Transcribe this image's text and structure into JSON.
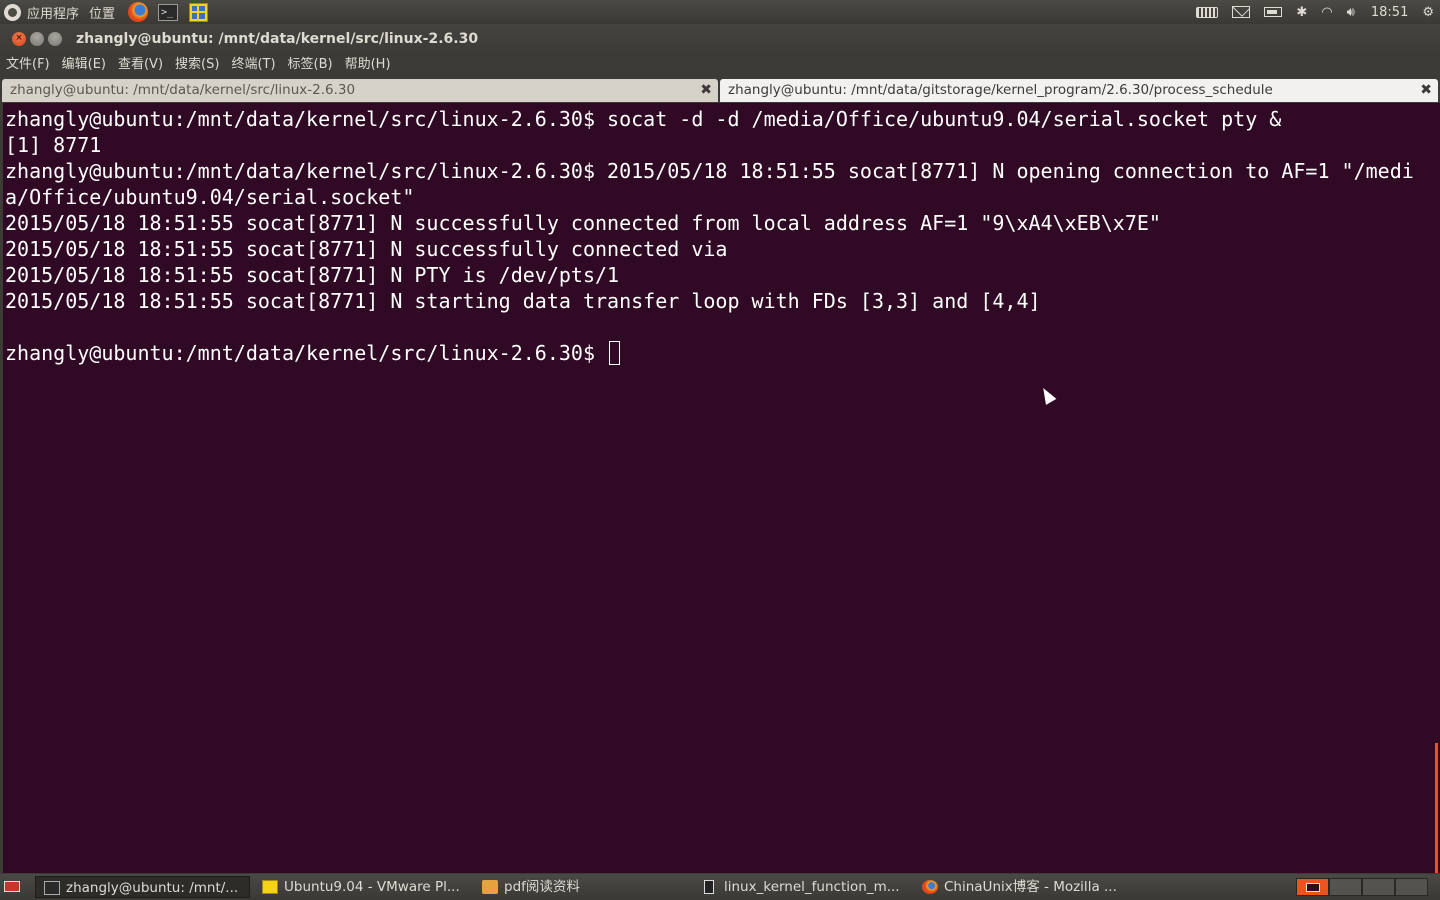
{
  "top_panel": {
    "applications_menu": "应用程序",
    "places_menu": "位置",
    "launchers": [
      "firefox-icon",
      "terminal-icon",
      "vmware-icon"
    ],
    "tray": [
      "keyboard-icon",
      "mail-icon",
      "battery-icon",
      "bluetooth-icon",
      "wifi-icon",
      "volume-icon"
    ],
    "clock": "18:51",
    "power_icon": "⚙"
  },
  "window": {
    "title": "zhangly@ubuntu: /mnt/data/kernel/src/linux-2.6.30",
    "buttons": {
      "close": "×",
      "minimize": "−",
      "maximize": "□"
    }
  },
  "menubar": {
    "items": [
      "文件(F)",
      "编辑(E)",
      "查看(V)",
      "搜索(S)",
      "终端(T)",
      "标签(B)",
      "帮助(H)"
    ]
  },
  "tabs": [
    {
      "label": "zhangly@ubuntu: /mnt/data/kernel/src/linux-2.6.30",
      "close": "✖",
      "active": true
    },
    {
      "label": "zhangly@ubuntu: /mnt/data/gitstorage/kernel_program/2.6.30/process_schedule",
      "close": "✖",
      "active": false
    }
  ],
  "terminal": {
    "background": "#300a24",
    "foreground": "#ffffff",
    "output": "zhangly@ubuntu:/mnt/data/kernel/src/linux-2.6.30$ socat -d -d /media/Office/ubuntu9.04/serial.socket pty &\n[1] 8771\nzhangly@ubuntu:/mnt/data/kernel/src/linux-2.6.30$ 2015/05/18 18:51:55 socat[8771] N opening connection to AF=1 \"/media/Office/ubuntu9.04/serial.socket\"\n2015/05/18 18:51:55 socat[8771] N successfully connected from local address AF=1 \"9\\xA4\\xEB\\x7E\"\n2015/05/18 18:51:55 socat[8771] N successfully connected via\n2015/05/18 18:51:55 socat[8771] N PTY is /dev/pts/1\n2015/05/18 18:51:55 socat[8771] N starting data transfer loop with FDs [3,3] and [4,4]\n\n",
    "prompt": "zhangly@ubuntu:/mnt/data/kernel/src/linux-2.6.30$ "
  },
  "taskbar": {
    "tasks": [
      {
        "label": "zhangly@ubuntu: /mnt/...",
        "icon": "terminal-icon",
        "active": true
      },
      {
        "label": "Ubuntu9.04 - VMware Pl...",
        "icon": "vmware-icon",
        "active": false
      },
      {
        "label": "pdf阅读资料",
        "icon": "folder-icon",
        "active": false
      },
      {
        "label": "linux_kernel_function_m...",
        "icon": "document-icon",
        "active": false
      },
      {
        "label": "ChinaUnix博客 - Mozilla ...",
        "icon": "firefox-icon",
        "active": false
      }
    ],
    "workspaces": 4,
    "accent": "#e95420"
  }
}
